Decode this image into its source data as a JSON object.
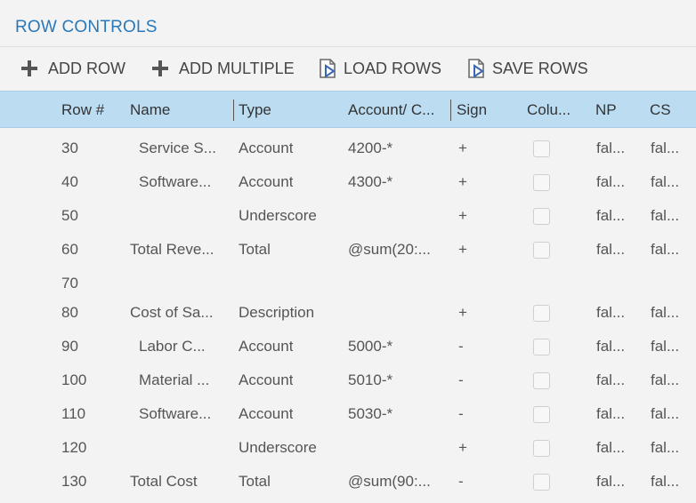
{
  "panel": {
    "title": "ROW CONTROLS"
  },
  "toolbar": {
    "add_row": "ADD ROW",
    "add_multiple": "ADD MULTIPLE",
    "load_rows": "LOAD ROWS",
    "save_rows": "SAVE ROWS"
  },
  "columns": {
    "row_num": "Row #",
    "name": "Name",
    "type": "Type",
    "account": "Account/ C...",
    "sign": "Sign",
    "column": "Colu...",
    "np": "NP",
    "cs": "CS"
  },
  "rows": [
    {
      "row_num": "30",
      "name": "Service S...",
      "type": "Account",
      "account": "4200-*",
      "sign": "+",
      "checkbox": true,
      "np": "fal...",
      "cs": "fal...",
      "indent": true
    },
    {
      "row_num": "40",
      "name": "Software...",
      "type": "Account",
      "account": "4300-*",
      "sign": "+",
      "checkbox": true,
      "np": "fal...",
      "cs": "fal...",
      "indent": true
    },
    {
      "row_num": "50",
      "name": "",
      "type": "Underscore",
      "account": "",
      "sign": "+",
      "checkbox": true,
      "np": "fal...",
      "cs": "fal...",
      "indent": false
    },
    {
      "row_num": "60",
      "name": "Total Reve...",
      "type": "Total",
      "account": "@sum(20:...",
      "sign": "+",
      "checkbox": true,
      "np": "fal...",
      "cs": "fal...",
      "indent": false
    },
    {
      "row_num": "70",
      "name": "",
      "type": "",
      "account": "",
      "sign": "",
      "checkbox": false,
      "np": "",
      "cs": "",
      "indent": false
    },
    {
      "row_num": "80",
      "name": "Cost of Sa...",
      "type": "Description",
      "account": "",
      "sign": "+",
      "checkbox": true,
      "np": "fal...",
      "cs": "fal...",
      "indent": false
    },
    {
      "row_num": "90",
      "name": "Labor C...",
      "type": "Account",
      "account": "5000-*",
      "sign": "-",
      "checkbox": true,
      "np": "fal...",
      "cs": "fal...",
      "indent": true
    },
    {
      "row_num": "100",
      "name": "Material ...",
      "type": "Account",
      "account": "5010-*",
      "sign": "-",
      "checkbox": true,
      "np": "fal...",
      "cs": "fal...",
      "indent": true
    },
    {
      "row_num": "110",
      "name": "Software...",
      "type": "Account",
      "account": "5030-*",
      "sign": "-",
      "checkbox": true,
      "np": "fal...",
      "cs": "fal...",
      "indent": true
    },
    {
      "row_num": "120",
      "name": "",
      "type": "Underscore",
      "account": "",
      "sign": "+",
      "checkbox": true,
      "np": "fal...",
      "cs": "fal...",
      "indent": false
    },
    {
      "row_num": "130",
      "name": "Total Cost",
      "type": "Total",
      "account": "@sum(90:...",
      "sign": "-",
      "checkbox": true,
      "np": "fal...",
      "cs": "fal...",
      "indent": false
    }
  ],
  "icons": {
    "add_row": "plus-icon",
    "add_multiple": "plus-icon",
    "load_rows": "document-play-icon",
    "save_rows": "document-play-icon"
  }
}
